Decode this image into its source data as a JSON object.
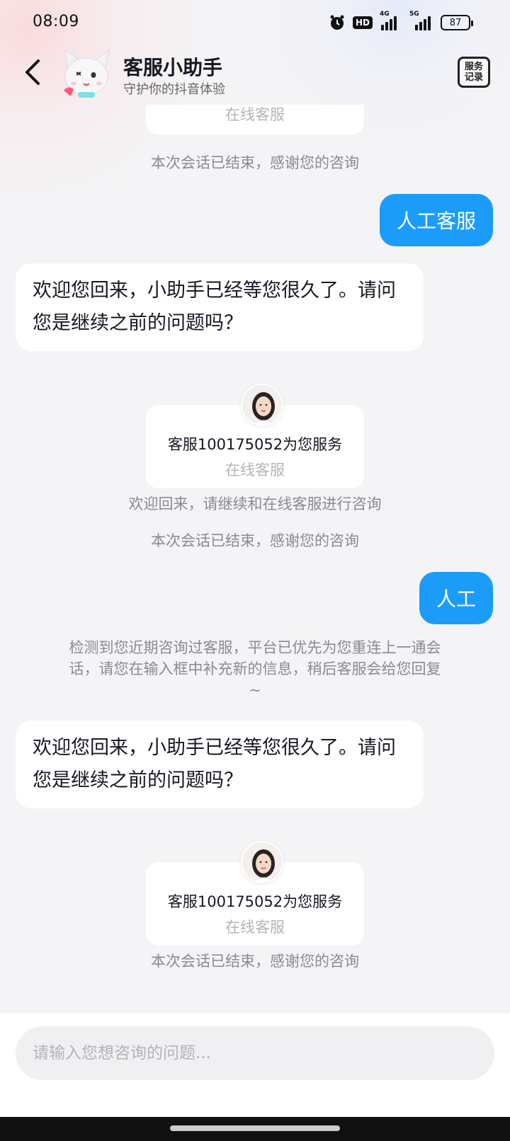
{
  "status_bar": {
    "time": "08:09",
    "hd": "HD",
    "net1": "4G",
    "net2": "5G",
    "battery": "87"
  },
  "header": {
    "title": "客服小助手",
    "subtitle": "守护你的抖音体验",
    "service_record_line1": "服务",
    "service_record_line2": "记录"
  },
  "messages": {
    "top_card_role": "在线客服",
    "ended_1": "本次会话已结束，感谢您的咨询",
    "user_1": "人工客服",
    "bot_1": "欢迎您回来，小助手已经等您很久了。请问您是继续之前的问题吗？",
    "card_1_name": "客服100175052为您服务",
    "card_1_role": "在线客服",
    "welcome_back": "欢迎回来，请继续和在线客服进行咨询",
    "ended_2": "本次会话已结束，感谢您的咨询",
    "user_2": "人工",
    "reconnect_notice": "检测到您近期咨询过客服，平台已优先为您重连上一通会话，请您在输入框中补充新的信息，稍后客服会给您回复 ~",
    "bot_2": "欢迎您回来，小助手已经等您很久了。请问您是继续之前的问题吗？",
    "card_2_name": "客服100175052为您服务",
    "card_2_role": "在线客服",
    "ended_3": "本次会话已结束，感谢您的咨询"
  },
  "input": {
    "placeholder": "请输入您想咨询的问题..."
  },
  "colors": {
    "accent": "#1c9cf9",
    "background": "#f4f4f6"
  }
}
